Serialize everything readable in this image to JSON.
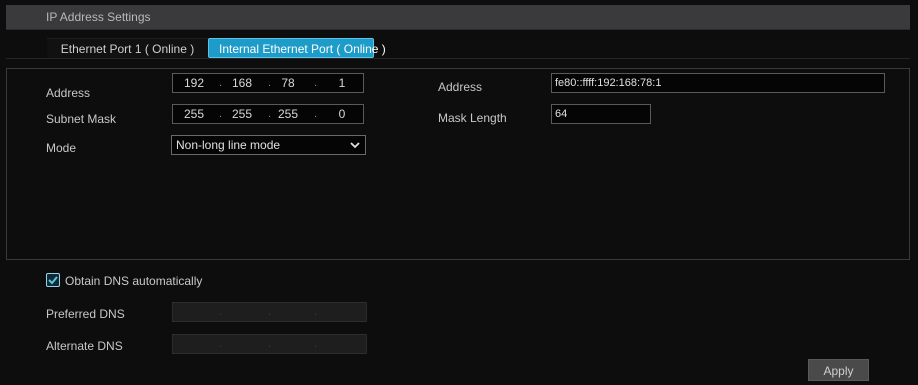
{
  "header": {
    "title": "IP Address Settings"
  },
  "tabs": [
    {
      "label": "Ethernet Port 1 ( Online )",
      "active": false
    },
    {
      "label": "Internal Ethernet Port ( Online )",
      "active": true
    }
  ],
  "ipv4": {
    "address_label": "Address",
    "address": [
      "192",
      "168",
      "78",
      "1"
    ],
    "subnet_label": "Subnet Mask",
    "subnet": [
      "255",
      "255",
      "255",
      "0"
    ],
    "mode_label": "Mode",
    "mode_value": "Non-long line mode"
  },
  "ipv6": {
    "address_label": "Address",
    "address_value": "fe80::ffff:192:168:78:1",
    "mask_label": "Mask Length",
    "mask_value": "64"
  },
  "dns": {
    "auto_label": "Obtain DNS automatically",
    "auto_checked": true,
    "preferred_label": "Preferred DNS",
    "alternate_label": "Alternate DNS"
  },
  "actions": {
    "apply_label": "Apply"
  },
  "colors": {
    "accent": "#1d9cc9",
    "background": "#0d0d0d",
    "title_bar": "#3a3a3c"
  },
  "icons": {
    "mode_select": "chevron-down-icon",
    "dns_checkbox": "checkmark-icon"
  }
}
